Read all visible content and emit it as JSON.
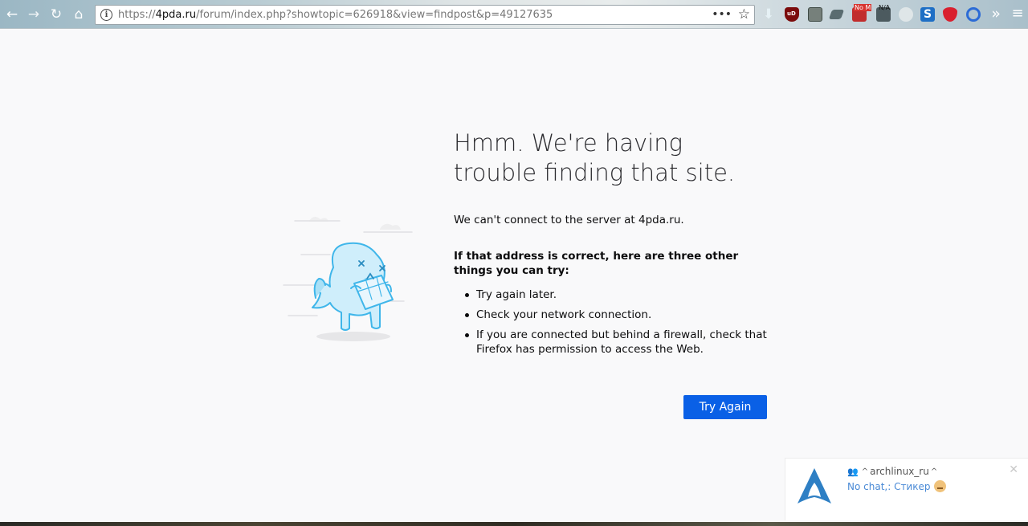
{
  "browser": {
    "url_prefix": "https://",
    "url_host": "4pda.ru",
    "url_path": "/forum/index.php?showtopic=626918&view=findpost&p=49127635",
    "nav_icons": [
      "back-icon",
      "forward-icon",
      "reload-icon",
      "home-icon"
    ],
    "extensions": {
      "nomail_label": "No M",
      "na_label": "N/A",
      "s_label": "S"
    }
  },
  "error_page": {
    "title": "Hmm. We're having trouble finding that site.",
    "description": "We can't connect to the server at 4pda.ru.",
    "suggestions_heading": "If that address is correct, here are three other things you can try:",
    "suggestions": [
      "Try again later.",
      "Check your network connection.",
      "If you are connected but behind a firewall, check that Firefox has permission to access the Web."
    ],
    "button_label": "Try Again"
  },
  "notification": {
    "title": "archlinux_ru",
    "message": "No chat,: Стикер"
  },
  "colors": {
    "primary_button": "#0a60e6",
    "page_background": "#f9f9fa",
    "illustration_stroke": "#3fb6ea"
  }
}
